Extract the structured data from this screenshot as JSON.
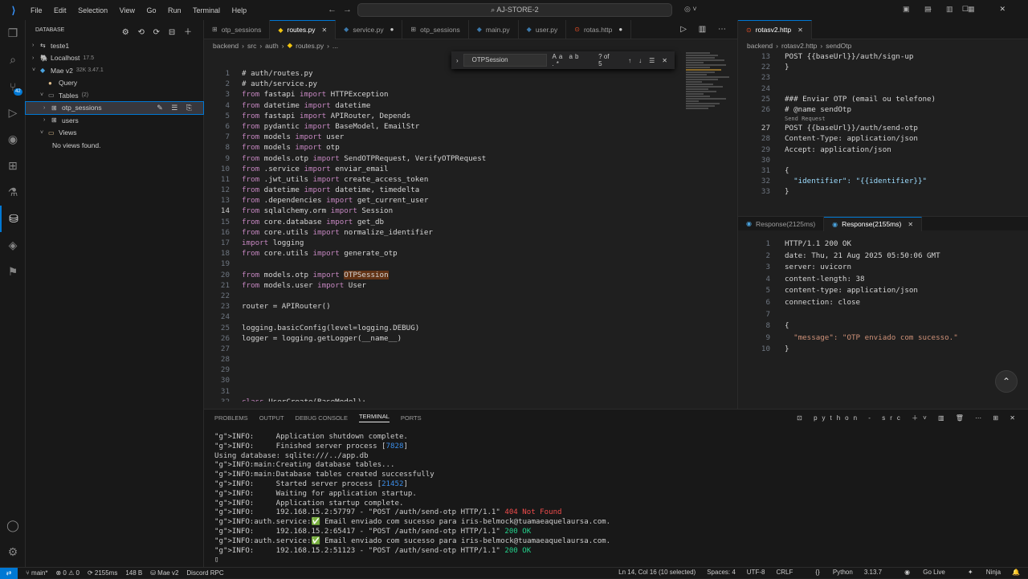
{
  "titlebar": {
    "menu": [
      "File",
      "Edit",
      "Selection",
      "View",
      "Go",
      "Run",
      "Terminal",
      "Help"
    ],
    "command_center": "AJ-STORE-2"
  },
  "activity": {
    "badge": "42"
  },
  "sidebar": {
    "title": "DATABASE",
    "rows": [
      {
        "label": "teste1",
        "meta": ""
      },
      {
        "label": "Localhost",
        "meta": "17.5"
      },
      {
        "label": "Mae v2",
        "meta": "32K 3.47.1"
      },
      {
        "label": "Query",
        "meta": ""
      },
      {
        "label": "Tables",
        "meta": "(2)"
      },
      {
        "label": "otp_sessions",
        "meta": ""
      },
      {
        "label": "users",
        "meta": ""
      },
      {
        "label": "Views",
        "meta": ""
      },
      {
        "label": "No views found.",
        "meta": ""
      }
    ]
  },
  "editor": {
    "tabs": [
      "otp_sessions",
      "routes.py",
      "service.py",
      "otp_sessions",
      "main.py",
      "user.py",
      "rotas.http"
    ],
    "breadcrumb": [
      "backend",
      "src",
      "auth",
      "routes.py",
      "..."
    ],
    "find": {
      "query": "OTPSession",
      "count": "? of 5",
      "options": "Aa ab .*"
    },
    "lines": [
      {
        "n": "1",
        "t": "# auth/routes.py"
      },
      {
        "n": "2",
        "t": "# auth/service.py"
      },
      {
        "n": "3",
        "t": "from fastapi import HTTPException"
      },
      {
        "n": "4",
        "t": "from datetime import datetime"
      },
      {
        "n": "5",
        "t": "from fastapi import APIRouter, Depends"
      },
      {
        "n": "6",
        "t": "from pydantic import BaseModel, EmailStr"
      },
      {
        "n": "7",
        "t": "from models import user"
      },
      {
        "n": "8",
        "t": "from models import otp"
      },
      {
        "n": "9",
        "t": "from models.otp import SendOTPRequest, VerifyOTPRequest"
      },
      {
        "n": "10",
        "t": "from .service import enviar_email"
      },
      {
        "n": "11",
        "t": "from .jwt_utils import create_access_token"
      },
      {
        "n": "12",
        "t": "from datetime import datetime, timedelta"
      },
      {
        "n": "13",
        "t": "from .dependencies import get_current_user"
      },
      {
        "n": "14",
        "t": "from sqlalchemy.orm import Session"
      },
      {
        "n": "15",
        "t": "from core.database import get_db"
      },
      {
        "n": "16",
        "t": "from core.utils import normalize_identifier"
      },
      {
        "n": "17",
        "t": "import logging"
      },
      {
        "n": "18",
        "t": "from core.utils import generate_otp"
      },
      {
        "n": "19",
        "t": ""
      },
      {
        "n": "20",
        "t": "from models.otp import OTPSession"
      },
      {
        "n": "21",
        "t": "from models.user import User"
      },
      {
        "n": "22",
        "t": ""
      },
      {
        "n": "23",
        "t": "router = APIRouter()"
      },
      {
        "n": "24",
        "t": ""
      },
      {
        "n": "25",
        "t": "logging.basicConfig(level=logging.DEBUG)"
      },
      {
        "n": "26",
        "t": "logger = logging.getLogger(__name__)"
      },
      {
        "n": "27",
        "t": ""
      },
      {
        "n": "28",
        "t": ""
      },
      {
        "n": "29",
        "t": ""
      },
      {
        "n": "30",
        "t": ""
      },
      {
        "n": "31",
        "t": ""
      },
      {
        "n": "32",
        "t": "class UserCreate(BaseModel):"
      }
    ]
  },
  "http": {
    "tab": "rotasv2.http",
    "breadcrumb": [
      "backend",
      "rotasv2.http",
      "sendOtp"
    ],
    "codelens": "Send Request",
    "lines": [
      {
        "n": "13",
        "t": "POST {{baseUrl}}/auth/sign-up"
      },
      {
        "n": "22",
        "t": "}"
      },
      {
        "n": "23",
        "t": ""
      },
      {
        "n": "24",
        "t": ""
      },
      {
        "n": "25",
        "t": "### Enviar OTP (email ou telefone)"
      },
      {
        "n": "26",
        "t": "# @name sendOtp"
      },
      {
        "n": "27",
        "t": "POST {{baseUrl}}/auth/send-otp"
      },
      {
        "n": "28",
        "t": "Content-Type: application/json"
      },
      {
        "n": "29",
        "t": "Accept: application/json"
      },
      {
        "n": "30",
        "t": ""
      },
      {
        "n": "31",
        "t": "{"
      },
      {
        "n": "32",
        "t": "  \"identifier\": \"{{identifier}}\""
      },
      {
        "n": "33",
        "t": "}"
      }
    ],
    "resp_tabs": [
      "Response(2125ms)",
      "Response(2155ms)"
    ],
    "response": [
      {
        "n": "1",
        "t": "HTTP/1.1 200 OK"
      },
      {
        "n": "2",
        "t": "date: Thu, 21 Aug 2025 05:50:06 GMT"
      },
      {
        "n": "3",
        "t": "server: uvicorn"
      },
      {
        "n": "4",
        "t": "content-length: 38"
      },
      {
        "n": "5",
        "t": "content-type: application/json"
      },
      {
        "n": "6",
        "t": "connection: close"
      },
      {
        "n": "7",
        "t": ""
      },
      {
        "n": "8",
        "t": "{"
      },
      {
        "n": "9",
        "t": "  \"message\": \"OTP enviado com sucesso.\""
      },
      {
        "n": "10",
        "t": "}"
      }
    ]
  },
  "panel": {
    "tabs": [
      "PROBLEMS",
      "OUTPUT",
      "DEBUG CONSOLE",
      "TERMINAL",
      "PORTS"
    ],
    "shell": "python - src",
    "lines": [
      "INFO:     Application shutdown complete.",
      "INFO:     Finished server process [7828]",
      "Using database: sqlite:///../app.db",
      "INFO:main:Creating database tables...",
      "INFO:main:Database tables created successfully",
      "INFO:     Started server process [21452]",
      "INFO:     Waiting for application startup.",
      "INFO:     Application startup complete.",
      "INFO:     192.168.15.2:57797 - \"POST /auth/send-otp HTTP/1.1\" 404 Not Found",
      "INFO:auth.service:✅ Email enviado com sucesso para iris-belmock@tuamaeaquelaursa.com.",
      "INFO:     192.168.15.2:65417 - \"POST /auth/send-otp HTTP/1.1\" 200 OK",
      "INFO:auth.service:✅ Email enviado com sucesso para iris-belmock@tuamaeaquelaursa.com.",
      "INFO:     192.168.15.2:51123 - \"POST /auth/send-otp HTTP/1.1\" 200 OK",
      "▯"
    ]
  },
  "status": {
    "left": [
      "main*",
      "⊗ 0 ⚠ 0",
      "⟳ 2155ms",
      "148 B",
      "Mae v2",
      "Discord RPC"
    ],
    "right": [
      "Ln 14, Col 16 (10 selected)",
      "Spaces: 4",
      "UTF-8",
      "CRLF",
      "Python",
      "3.13.7",
      "Go Live",
      "Ninja"
    ]
  }
}
